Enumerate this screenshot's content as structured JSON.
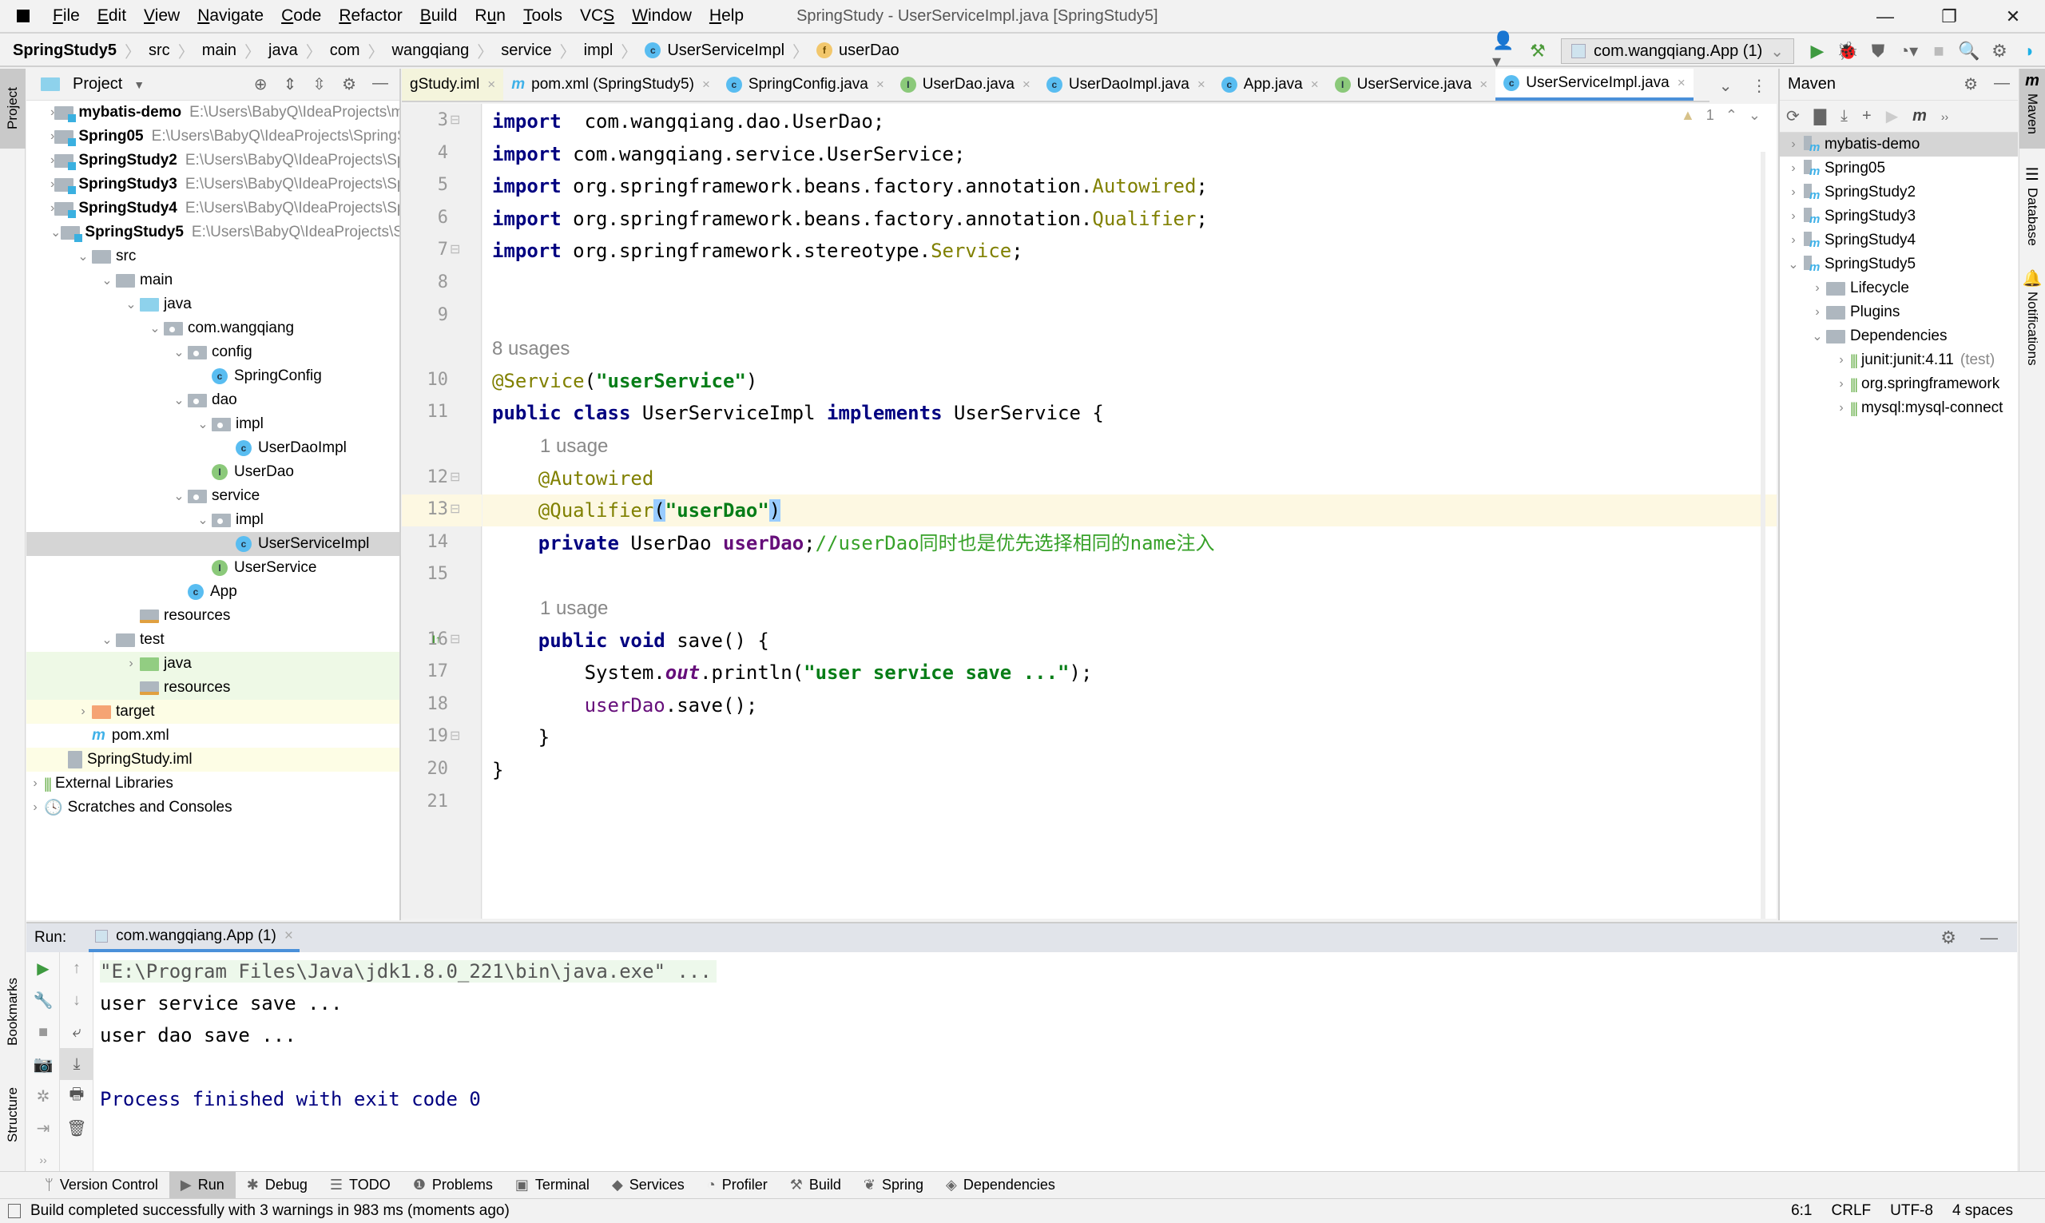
{
  "window": {
    "title": "SpringStudy - UserServiceImpl.java [SpringStudy5]",
    "controls": {
      "minimize": "—",
      "maximize": "❐",
      "close": "✕"
    }
  },
  "menu": [
    {
      "label": "File",
      "mnemonic": "F",
      "rest": "ile"
    },
    {
      "label": "Edit",
      "mnemonic": "E",
      "rest": "dit"
    },
    {
      "label": "View",
      "mnemonic": "V",
      "rest": "iew"
    },
    {
      "label": "Navigate",
      "mnemonic": "N",
      "rest": "avigate"
    },
    {
      "label": "Code",
      "mnemonic": "C",
      "rest": "ode"
    },
    {
      "label": "Refactor",
      "mnemonic": "R",
      "rest": "efactor"
    },
    {
      "label": "Build",
      "mnemonic": "B",
      "rest": "uild"
    },
    {
      "label": "Run",
      "mnemonic": "u",
      "rest": "n",
      "prefix": "R"
    },
    {
      "label": "Tools",
      "mnemonic": "T",
      "rest": "ools"
    },
    {
      "label": "VCS",
      "mnemonic": "S",
      "rest": "",
      "prefix": "VC"
    },
    {
      "label": "Window",
      "mnemonic": "W",
      "rest": "indow"
    },
    {
      "label": "Help",
      "mnemonic": "H",
      "rest": "elp"
    }
  ],
  "breadcrumb": [
    "SpringStudy5",
    "src",
    "main",
    "java",
    "com",
    "wangqiang",
    "service",
    "impl",
    "UserServiceImpl",
    "userDao"
  ],
  "toolbar": {
    "run_config": "com.wangqiang.App (1)",
    "icons": [
      "user-icon",
      "hammer-icon",
      "run-icon",
      "debug-icon",
      "coverage-icon",
      "profiler-icon",
      "stop-icon",
      "search-icon",
      "settings-icon",
      "jetbrains-logo-icon"
    ]
  },
  "left_strip": {
    "project_tab": "Project",
    "bookmarks_tab": "Bookmarks",
    "structure_tab": "Structure"
  },
  "project_panel": {
    "title": "Project",
    "tree": [
      {
        "label": "mybatis-demo",
        "path": "E:\\Users\\BabyQ\\IdeaProjects\\m",
        "depth": 0,
        "chevron": ">",
        "icon": "module",
        "bold": true
      },
      {
        "label": "Spring05",
        "path": "E:\\Users\\BabyQ\\IdeaProjects\\SpringS",
        "depth": 0,
        "chevron": ">",
        "icon": "module",
        "bold": true
      },
      {
        "label": "SpringStudy2",
        "path": "E:\\Users\\BabyQ\\IdeaProjects\\Spr",
        "depth": 0,
        "chevron": ">",
        "icon": "module",
        "bold": true
      },
      {
        "label": "SpringStudy3",
        "path": "E:\\Users\\BabyQ\\IdeaProjects\\Spr",
        "depth": 0,
        "chevron": ">",
        "icon": "module",
        "bold": true
      },
      {
        "label": "SpringStudy4",
        "path": "E:\\Users\\BabyQ\\IdeaProjects\\Spr",
        "depth": 0,
        "chevron": ">",
        "icon": "module",
        "bold": true
      },
      {
        "label": "SpringStudy5",
        "path": "E:\\Users\\BabyQ\\IdeaProjects\\Spr",
        "depth": 0,
        "chevron": "v",
        "icon": "module",
        "bold": true
      },
      {
        "label": "src",
        "depth": 1,
        "chevron": "v",
        "icon": "folder"
      },
      {
        "label": "main",
        "depth": 2,
        "chevron": "v",
        "icon": "folder"
      },
      {
        "label": "java",
        "depth": 3,
        "chevron": "v",
        "icon": "folder-blue"
      },
      {
        "label": "com.wangqiang",
        "depth": 4,
        "chevron": "v",
        "icon": "package"
      },
      {
        "label": "config",
        "depth": 5,
        "chevron": "v",
        "icon": "package"
      },
      {
        "label": "SpringConfig",
        "depth": 6,
        "chevron": "",
        "icon": "class"
      },
      {
        "label": "dao",
        "depth": 5,
        "chevron": "v",
        "icon": "package"
      },
      {
        "label": "impl",
        "depth": 6,
        "chevron": "v",
        "icon": "package"
      },
      {
        "label": "UserDaoImpl",
        "depth": 7,
        "chevron": "",
        "icon": "class"
      },
      {
        "label": "UserDao",
        "depth": 6,
        "chevron": "",
        "icon": "interface"
      },
      {
        "label": "service",
        "depth": 5,
        "chevron": "v",
        "icon": "package"
      },
      {
        "label": "impl",
        "depth": 6,
        "chevron": "v",
        "icon": "package"
      },
      {
        "label": "UserServiceImpl",
        "depth": 7,
        "chevron": "",
        "icon": "class",
        "selected": true
      },
      {
        "label": "UserService",
        "depth": 6,
        "chevron": "",
        "icon": "interface"
      },
      {
        "label": "App",
        "depth": 5,
        "chevron": "",
        "icon": "class-run"
      },
      {
        "label": "resources",
        "depth": 3,
        "chevron": "",
        "icon": "folder-res"
      },
      {
        "label": "test",
        "depth": 2,
        "chevron": "v",
        "icon": "folder"
      },
      {
        "label": "java",
        "depth": 3,
        "chevron": ">",
        "icon": "folder-green",
        "hl": "green"
      },
      {
        "label": "resources",
        "depth": 3,
        "chevron": "",
        "icon": "folder-res",
        "hl": "green"
      },
      {
        "label": "target",
        "depth": 1,
        "chevron": ">",
        "icon": "folder-orange",
        "hl": "yellow"
      },
      {
        "label": "pom.xml",
        "depth": 1,
        "chevron": "",
        "icon": "maven"
      },
      {
        "label": "SpringStudy.iml",
        "depth": 0,
        "chevron": "",
        "icon": "iml",
        "hl": "yellow"
      },
      {
        "label": "External Libraries",
        "depth": -1,
        "chevron": ">",
        "icon": "libraries"
      },
      {
        "label": "Scratches and Consoles",
        "depth": -1,
        "chevron": ">",
        "icon": "scratches"
      }
    ]
  },
  "editor": {
    "tabs": [
      {
        "label": "gStudy.iml",
        "icon": "iml",
        "active": false
      },
      {
        "label": "pom.xml (SpringStudy5)",
        "icon": "maven",
        "active": false
      },
      {
        "label": "SpringConfig.java",
        "icon": "class",
        "active": false
      },
      {
        "label": "UserDao.java",
        "icon": "interface",
        "active": false
      },
      {
        "label": "UserDaoImpl.java",
        "icon": "class",
        "active": false
      },
      {
        "label": "App.java",
        "icon": "class",
        "active": false
      },
      {
        "label": "UserService.java",
        "icon": "interface",
        "active": false
      },
      {
        "label": "UserServiceImpl.java",
        "icon": "class",
        "active": true
      }
    ],
    "warnings_count": "1",
    "lines": [
      {
        "num": "3",
        "html_tokens": [
          [
            "kw",
            "import"
          ],
          [
            "",
            "  com.wangqiang.dao.UserDao;"
          ]
        ]
      },
      {
        "num": "4",
        "html_tokens": [
          [
            "kw",
            "import"
          ],
          [
            "",
            " com.wangqiang.service.UserService;"
          ]
        ]
      },
      {
        "num": "5",
        "html_tokens": [
          [
            "kw",
            "import"
          ],
          [
            "",
            " org.springframework.beans.factory.annotation."
          ],
          [
            "ann",
            "Autowired"
          ],
          [
            "",
            ";"
          ]
        ]
      },
      {
        "num": "6",
        "html_tokens": [
          [
            "kw",
            "import"
          ],
          [
            "",
            " org.springframework.beans.factory.annotation."
          ],
          [
            "ann",
            "Qualifier"
          ],
          [
            "",
            ";"
          ]
        ]
      },
      {
        "num": "7",
        "html_tokens": [
          [
            "kw",
            "import"
          ],
          [
            "",
            " org.springframework.stereotype."
          ],
          [
            "ann",
            "Service"
          ],
          [
            "",
            ";"
          ]
        ]
      },
      {
        "num": "8",
        "html_tokens": []
      },
      {
        "num": "9",
        "html_tokens": []
      },
      {
        "num": "",
        "hint": "8 usages"
      },
      {
        "num": "10",
        "html_tokens": [
          [
            "ann",
            "@Service"
          ],
          [
            "",
            "("
          ],
          [
            "str",
            "\"userService\""
          ],
          [
            "",
            ")"
          ]
        ]
      },
      {
        "num": "11",
        "html_tokens": [
          [
            "kw",
            "public class"
          ],
          [
            "",
            " UserServiceImpl "
          ],
          [
            "kw",
            "implements"
          ],
          [
            "",
            " UserService {"
          ]
        ]
      },
      {
        "num": "",
        "hint": "1 usage",
        "indent": 1
      },
      {
        "num": "12",
        "html_tokens": [
          [
            "",
            "    "
          ],
          [
            "ann",
            "@Autowired"
          ]
        ]
      },
      {
        "num": "13",
        "caret": true,
        "html_tokens": [
          [
            "",
            "    "
          ],
          [
            "ann",
            "@Qualifier"
          ],
          [
            "brace",
            "("
          ],
          [
            "str",
            "\"userDao\""
          ],
          [
            "brace",
            ")"
          ]
        ]
      },
      {
        "num": "14",
        "html_tokens": [
          [
            "",
            "    "
          ],
          [
            "kw",
            "private"
          ],
          [
            "",
            " UserDao "
          ],
          [
            "fld",
            "userDao"
          ],
          [
            "",
            ";"
          ],
          [
            "cmt",
            "//userDao同时也是优先选择相同的name注入"
          ]
        ]
      },
      {
        "num": "15",
        "html_tokens": []
      },
      {
        "num": "",
        "hint": "1 usage",
        "indent": 1
      },
      {
        "num": "16",
        "html_tokens": [
          [
            "",
            "    "
          ],
          [
            "kw",
            "public void"
          ],
          [
            "",
            " save() {"
          ]
        ]
      },
      {
        "num": "17",
        "html_tokens": [
          [
            "",
            "        System."
          ],
          [
            "st",
            "out"
          ],
          [
            "",
            ".println("
          ],
          [
            "str",
            "\"user service save ...\""
          ],
          [
            "",
            ");"
          ]
        ]
      },
      {
        "num": "18",
        "html_tokens": [
          [
            "",
            "        "
          ],
          [
            "fldn",
            "userDao"
          ],
          [
            "",
            ".save();"
          ]
        ]
      },
      {
        "num": "19",
        "html_tokens": [
          [
            "",
            "    }"
          ]
        ]
      },
      {
        "num": "20",
        "html_tokens": [
          [
            "",
            "}"
          ]
        ]
      },
      {
        "num": "21",
        "html_tokens": []
      }
    ]
  },
  "maven_panel": {
    "title": "Maven",
    "projects": [
      {
        "label": "mybatis-demo",
        "chevron": ">",
        "depth": 0,
        "icon": "maven-project",
        "selected": true
      },
      {
        "label": "Spring05",
        "chevron": ">",
        "depth": 0,
        "icon": "maven-project"
      },
      {
        "label": "SpringStudy2",
        "chevron": ">",
        "depth": 0,
        "icon": "maven-project"
      },
      {
        "label": "SpringStudy3",
        "chevron": ">",
        "depth": 0,
        "icon": "maven-project"
      },
      {
        "label": "SpringStudy4",
        "chevron": ">",
        "depth": 0,
        "icon": "maven-project"
      },
      {
        "label": "SpringStudy5",
        "chevron": "v",
        "depth": 0,
        "icon": "maven-project"
      },
      {
        "label": "Lifecycle",
        "chevron": ">",
        "depth": 1,
        "icon": "folder-gear"
      },
      {
        "label": "Plugins",
        "chevron": ">",
        "depth": 1,
        "icon": "folder-gear"
      },
      {
        "label": "Dependencies",
        "chevron": "v",
        "depth": 1,
        "icon": "folder-deps"
      },
      {
        "label": "junit:junit:4.11",
        "suffix": "(test)",
        "chevron": ">",
        "depth": 2,
        "icon": "library"
      },
      {
        "label": "org.springframework",
        "chevron": ">",
        "depth": 2,
        "icon": "library"
      },
      {
        "label": "mysql:mysql-connect",
        "chevron": ">",
        "depth": 2,
        "icon": "library"
      }
    ]
  },
  "right_strip": {
    "maven_tab": "Maven",
    "database_tab": "Database",
    "notifications_tab": "Notifications"
  },
  "run_panel": {
    "label": "Run:",
    "tab": "com.wangqiang.App (1)",
    "console": [
      {
        "text": "\"E:\\Program Files\\Java\\jdk1.8.0_221\\bin\\java.exe\" ...",
        "kind": "cmd"
      },
      {
        "text": "user service save ...",
        "kind": "out"
      },
      {
        "text": "user dao save ...",
        "kind": "out"
      },
      {
        "text": "",
        "kind": "out"
      },
      {
        "text": "Process finished with exit code 0",
        "kind": "exit"
      }
    ]
  },
  "bottom_tabs": [
    {
      "label": "Version Control",
      "icon": "vcs-icon"
    },
    {
      "label": "Run",
      "icon": "run-icon",
      "active": true
    },
    {
      "label": "Debug",
      "icon": "debug-icon"
    },
    {
      "label": "TODO",
      "icon": "todo-icon"
    },
    {
      "label": "Problems",
      "icon": "problems-icon"
    },
    {
      "label": "Terminal",
      "icon": "terminal-icon"
    },
    {
      "label": "Services",
      "icon": "services-icon"
    },
    {
      "label": "Profiler",
      "icon": "profiler-icon"
    },
    {
      "label": "Build",
      "icon": "build-icon"
    },
    {
      "label": "Spring",
      "icon": "spring-icon"
    },
    {
      "label": "Dependencies",
      "icon": "dependencies-icon"
    }
  ],
  "status_bar": {
    "message": "Build completed successfully with 3 warnings in 983 ms (moments ago)",
    "position": "6:1",
    "line_separator": "CRLF",
    "encoding": "UTF-8",
    "indent": "4 spaces"
  },
  "colors": {
    "keyword": "#000080",
    "annotation": "#808000",
    "string": "#067d17",
    "field": "#660e7a",
    "comment": "#36a128",
    "accent": "#4a90d9",
    "selection": "#d5d5d5"
  }
}
